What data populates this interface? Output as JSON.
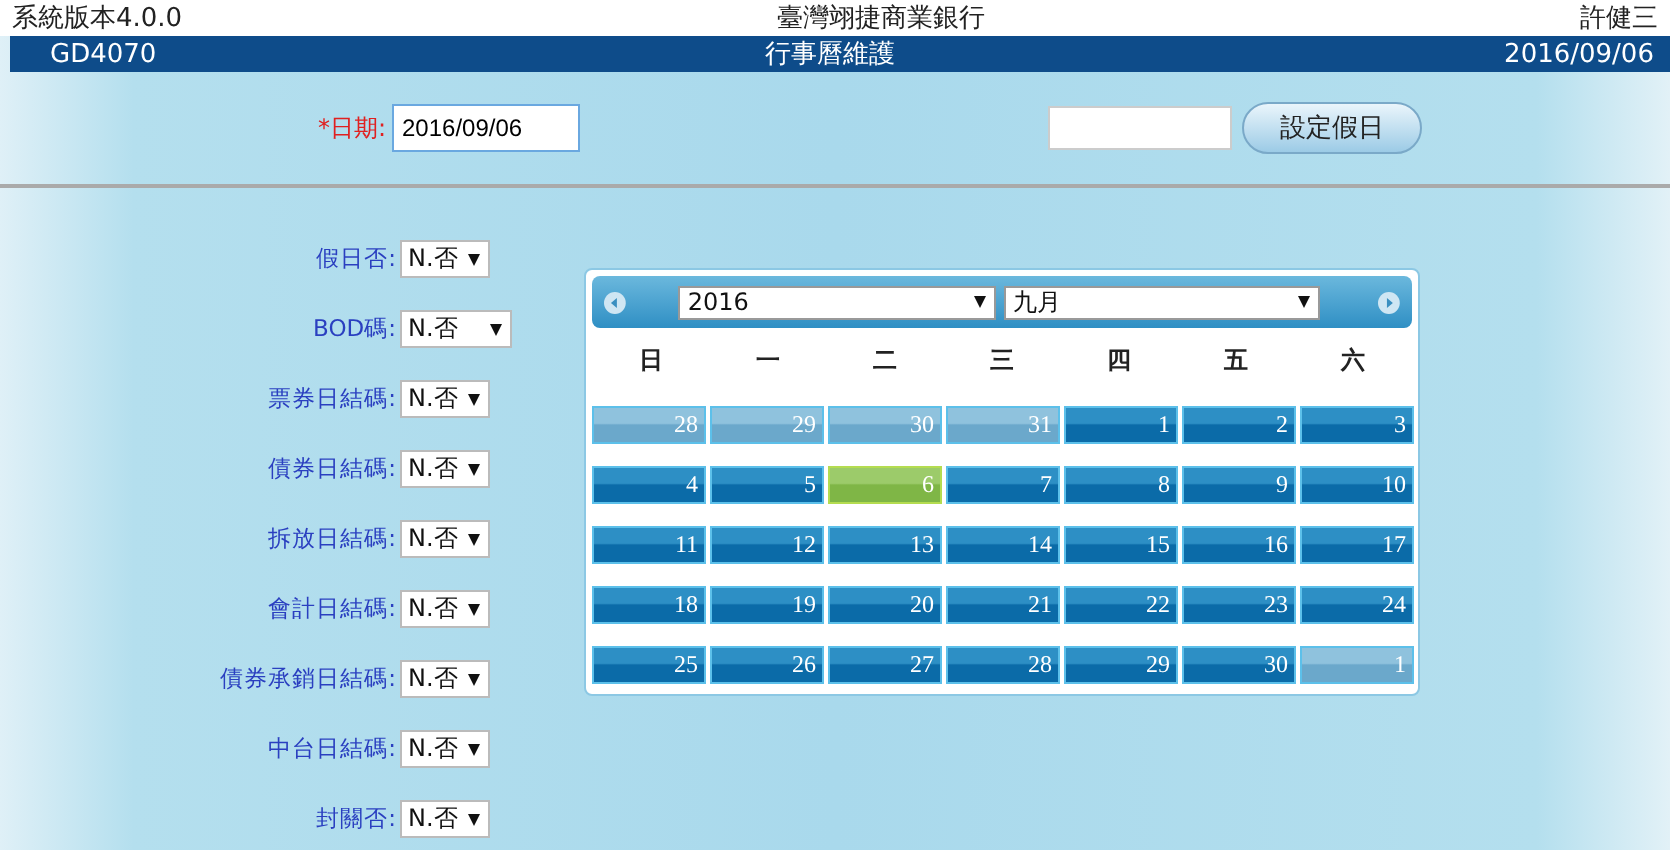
{
  "top_bar": {
    "version": "系統版本4.0.0",
    "bank": "臺灣翊捷商業銀行",
    "user": "許健三"
  },
  "title_bar": {
    "code": "GD4070",
    "title": "行事曆維護",
    "date": "2016/09/06"
  },
  "date_field": {
    "label": "*日期:",
    "value": "2016/09/06"
  },
  "set_holiday_button": "設定假日",
  "form_rows": [
    {
      "label": "假日否:",
      "value": "N.否",
      "wide": false
    },
    {
      "label": "BOD碼:",
      "value": "N.否",
      "wide": true
    },
    {
      "label": "票券日結碼:",
      "value": "N.否",
      "wide": false
    },
    {
      "label": "債券日結碼:",
      "value": "N.否",
      "wide": false
    },
    {
      "label": "拆放日結碼:",
      "value": "N.否",
      "wide": false
    },
    {
      "label": "會計日結碼:",
      "value": "N.否",
      "wide": false
    },
    {
      "label": "債券承銷日結碼:",
      "value": "N.否",
      "wide": false
    },
    {
      "label": "中台日結碼:",
      "value": "N.否",
      "wide": false
    },
    {
      "label": "封關否:",
      "value": "N.否",
      "wide": false
    }
  ],
  "calendar": {
    "year": "2016",
    "month": "九月",
    "weekdays": [
      "日",
      "一",
      "二",
      "三",
      "四",
      "五",
      "六"
    ],
    "days": [
      {
        "label": "28",
        "kind": "other",
        "selected": false
      },
      {
        "label": "29",
        "kind": "other",
        "selected": false
      },
      {
        "label": "30",
        "kind": "other",
        "selected": false
      },
      {
        "label": "31",
        "kind": "other",
        "selected": false
      },
      {
        "label": "1",
        "kind": "current",
        "selected": false
      },
      {
        "label": "2",
        "kind": "current",
        "selected": false
      },
      {
        "label": "3",
        "kind": "current",
        "selected": false
      },
      {
        "label": "4",
        "kind": "current",
        "selected": false
      },
      {
        "label": "5",
        "kind": "current",
        "selected": false
      },
      {
        "label": "6",
        "kind": "current",
        "selected": true
      },
      {
        "label": "7",
        "kind": "current",
        "selected": false
      },
      {
        "label": "8",
        "kind": "current",
        "selected": false
      },
      {
        "label": "9",
        "kind": "current",
        "selected": false
      },
      {
        "label": "10",
        "kind": "current",
        "selected": false
      },
      {
        "label": "11",
        "kind": "current",
        "selected": false
      },
      {
        "label": "12",
        "kind": "current",
        "selected": false
      },
      {
        "label": "13",
        "kind": "current",
        "selected": false
      },
      {
        "label": "14",
        "kind": "current",
        "selected": false
      },
      {
        "label": "15",
        "kind": "current",
        "selected": false
      },
      {
        "label": "16",
        "kind": "current",
        "selected": false
      },
      {
        "label": "17",
        "kind": "current",
        "selected": false
      },
      {
        "label": "18",
        "kind": "current",
        "selected": false
      },
      {
        "label": "19",
        "kind": "current",
        "selected": false
      },
      {
        "label": "20",
        "kind": "current",
        "selected": false
      },
      {
        "label": "21",
        "kind": "current",
        "selected": false
      },
      {
        "label": "22",
        "kind": "current",
        "selected": false
      },
      {
        "label": "23",
        "kind": "current",
        "selected": false
      },
      {
        "label": "24",
        "kind": "current",
        "selected": false
      },
      {
        "label": "25",
        "kind": "current",
        "selected": false
      },
      {
        "label": "26",
        "kind": "current",
        "selected": false
      },
      {
        "label": "27",
        "kind": "current",
        "selected": false
      },
      {
        "label": "28",
        "kind": "current",
        "selected": false
      },
      {
        "label": "29",
        "kind": "current",
        "selected": false
      },
      {
        "label": "30",
        "kind": "current",
        "selected": false
      },
      {
        "label": "1",
        "kind": "other",
        "selected": false
      }
    ]
  }
}
